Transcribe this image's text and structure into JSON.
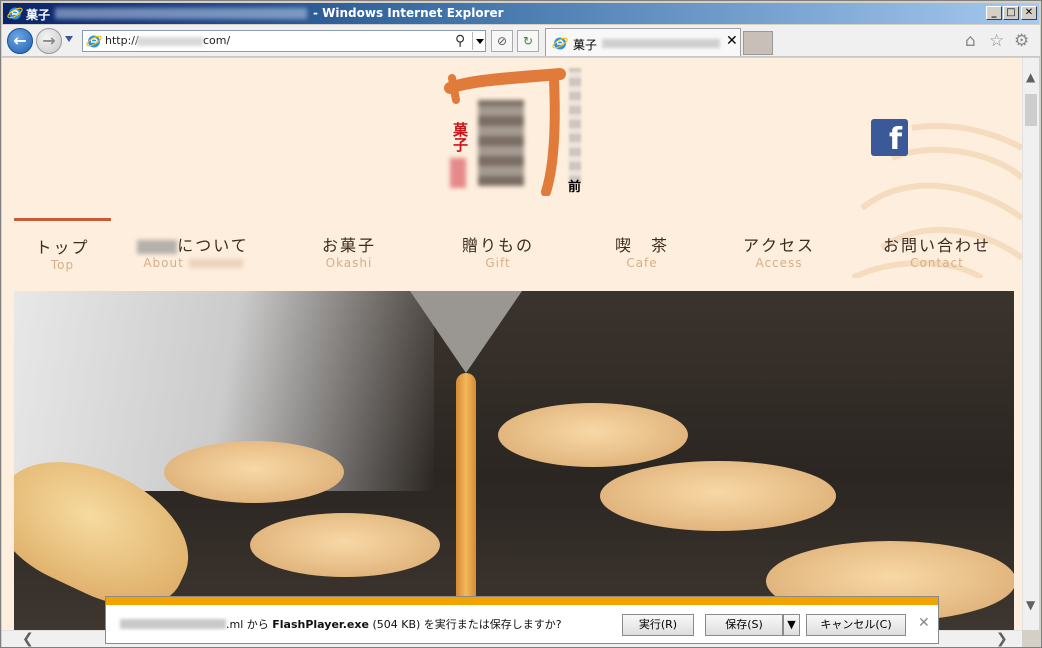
{
  "window": {
    "title_prefix": "菓子",
    "title_suffix": "- Windows Internet Explorer",
    "minimize": "_",
    "maximize": "□",
    "close": "✕"
  },
  "toolbar": {
    "back_glyph": "←",
    "forward_glyph": "→",
    "url_prefix": "http://",
    "url_suffix": "com/",
    "search_glyph": "⚲",
    "stop_glyph": "⊘",
    "refresh_glyph": "↻",
    "tab_title": "菓子",
    "tab_close": "✕",
    "home_glyph": "⌂",
    "favorites_glyph": "☆",
    "tools_glyph": "⚙"
  },
  "site": {
    "logo_red": "菓子",
    "logo_mae": "前",
    "facebook_glyph": "f",
    "nav": [
      {
        "jp": "トップ",
        "en": "Top"
      },
      {
        "jp": "について",
        "en": "About"
      },
      {
        "jp": "お菓子",
        "en": "Okashi"
      },
      {
        "jp": "贈りもの",
        "en": "Gift"
      },
      {
        "jp": "喫　茶",
        "en": "Cafe"
      },
      {
        "jp": "アクセス",
        "en": "Access"
      },
      {
        "jp": "お問い合わせ",
        "en": "Contact"
      }
    ]
  },
  "scroll": {
    "up": "▲",
    "down": "▼",
    "left": "❮",
    "right": "❯"
  },
  "download": {
    "host_suffix": ".ml から ",
    "filename": "FlashPlayer.exe",
    "rest": " (504 KB) を実行または保存しますか?",
    "run": "実行(R)",
    "save": "保存(S)",
    "save_drop": "▼",
    "cancel": "キャンセル(C)",
    "close": "✕"
  }
}
